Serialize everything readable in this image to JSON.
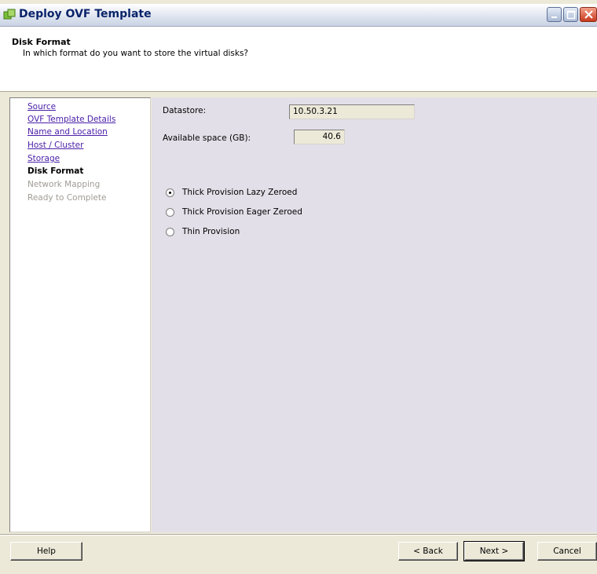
{
  "window": {
    "title": "Deploy OVF Template"
  },
  "header": {
    "title": "Disk Format",
    "subtitle": "In which format do you want to store the virtual disks?"
  },
  "nav": {
    "items": [
      {
        "label": "Source",
        "state": "link"
      },
      {
        "label": "OVF Template Details",
        "state": "link"
      },
      {
        "label": "Name and Location",
        "state": "link"
      },
      {
        "label": "Host / Cluster",
        "state": "link"
      },
      {
        "label": "Storage",
        "state": "link"
      },
      {
        "label": "Disk Format",
        "state": "current"
      },
      {
        "label": "Network Mapping",
        "state": "disabled"
      },
      {
        "label": "Ready to Complete",
        "state": "disabled"
      }
    ]
  },
  "form": {
    "datastore_label": "Datastore:",
    "datastore_value": "10.50.3.21",
    "available_label": "Available space (GB):",
    "available_value": "40.6",
    "options": [
      {
        "label": "Thick Provision Lazy Zeroed",
        "selected": true
      },
      {
        "label": "Thick Provision Eager Zeroed",
        "selected": false
      },
      {
        "label": "Thin Provision",
        "selected": false
      }
    ]
  },
  "buttons": {
    "help": "Help",
    "back": "< Back",
    "next": "Next >",
    "cancel": "Cancel"
  }
}
